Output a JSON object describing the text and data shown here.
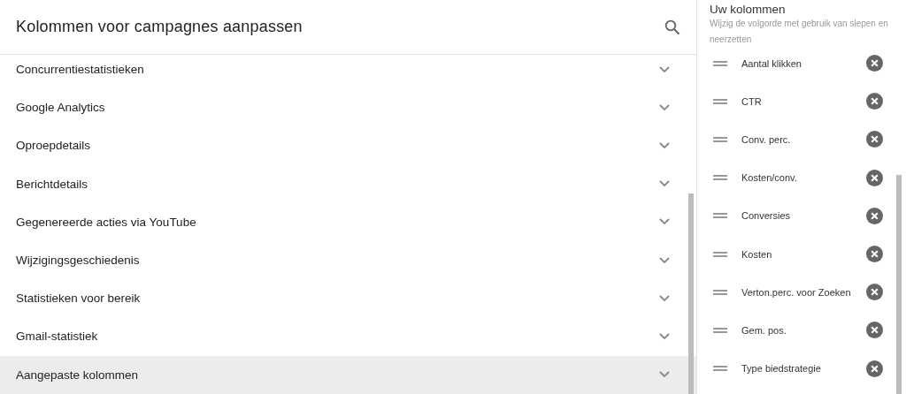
{
  "title": "Kolommen voor campagnes aanpassen",
  "categories": [
    {
      "label": "Concurrentiestatistieken",
      "selected": false
    },
    {
      "label": "Google Analytics",
      "selected": false
    },
    {
      "label": "Oproepdetails",
      "selected": false
    },
    {
      "label": "Berichtdetails",
      "selected": false
    },
    {
      "label": "Gegenereerde acties via YouTube",
      "selected": false
    },
    {
      "label": "Wijzigingsgeschiedenis",
      "selected": false
    },
    {
      "label": "Statistieken voor bereik",
      "selected": false
    },
    {
      "label": "Gmail-statistiek",
      "selected": false
    },
    {
      "label": "Aangepaste kolommen",
      "selected": true
    }
  ],
  "your_columns": {
    "title": "Uw kolommen",
    "subtitle": "Wijzig de volgorde met gebruik van slepen en neerzetten",
    "items": [
      "Aantal klikken",
      "CTR",
      "Conv. perc.",
      "Kosten/conv.",
      "Conversies",
      "Kosten",
      "Verton.perc. voor Zoeken",
      "Gem. pos.",
      "Type biedstrategie"
    ]
  }
}
